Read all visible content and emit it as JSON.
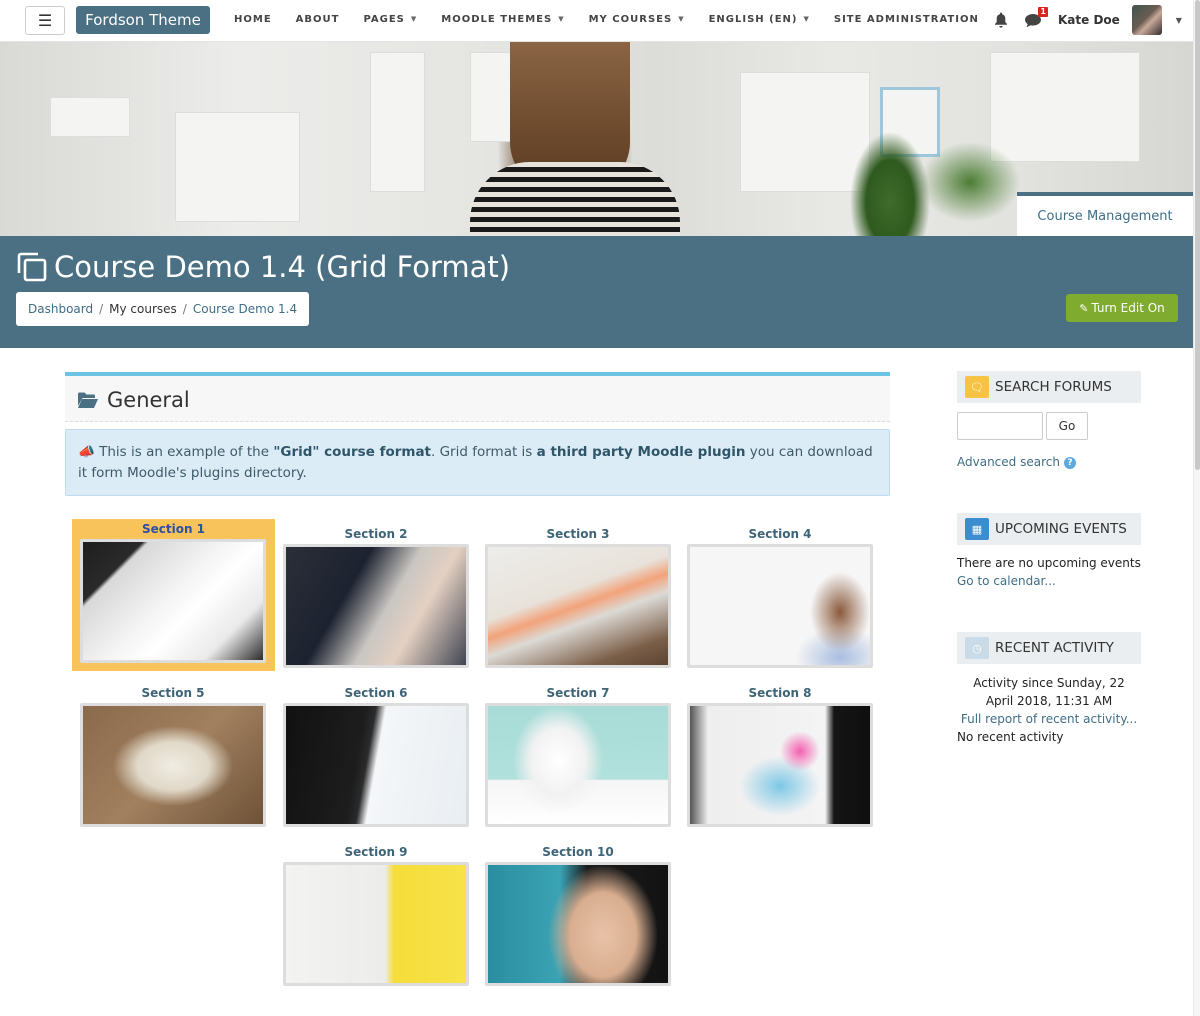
{
  "navbar": {
    "brand": "Fordson Theme",
    "menu": [
      {
        "label": "HOME",
        "dropdown": false
      },
      {
        "label": "ABOUT",
        "dropdown": false
      },
      {
        "label": "PAGES",
        "dropdown": true
      },
      {
        "label": "MOODLE THEMES",
        "dropdown": true
      },
      {
        "label": "MY COURSES",
        "dropdown": true
      },
      {
        "label": "ENGLISH (EN)",
        "dropdown": true
      },
      {
        "label": "SITE ADMINISTRATION",
        "dropdown": false
      }
    ],
    "notifications_icon": "bell-icon",
    "messages_icon": "comment-icon",
    "messages_count": "1",
    "user_name": "Kate Doe",
    "caret": "▾"
  },
  "hero": {
    "course_management_label": "Course Management"
  },
  "header": {
    "title": "Course Demo 1.4 (Grid Format)",
    "breadcrumb": [
      {
        "label": "Dashboard",
        "link": true
      },
      {
        "label": "My courses",
        "link": false
      },
      {
        "label": "Course Demo 1.4",
        "link": true
      }
    ],
    "breadcrumb_separator": "/",
    "edit_button_label": "Turn Edit On"
  },
  "general": {
    "title": "General",
    "notice_parts": {
      "p1": "This is an example of the ",
      "b1": "\"Grid\" course format",
      "p2": ". Grid format is ",
      "b2": "a third party Moodle plugin",
      "p3": " you can download it form Moodle's plugins directory."
    }
  },
  "sections": [
    {
      "label": "Section 1",
      "active": true
    },
    {
      "label": "Section 2",
      "active": false
    },
    {
      "label": "Section 3",
      "active": false
    },
    {
      "label": "Section 4",
      "active": false
    },
    {
      "label": "Section 5",
      "active": false
    },
    {
      "label": "Section 6",
      "active": false
    },
    {
      "label": "Section 7",
      "active": false
    },
    {
      "label": "Section 8",
      "active": false
    },
    {
      "label": "Section 9",
      "active": false
    },
    {
      "label": "Section 10",
      "active": false
    }
  ],
  "sidebar": {
    "search_forums": {
      "title": "SEARCH FORUMS",
      "input_value": "",
      "go_label": "Go",
      "advanced_search": "Advanced search",
      "help_glyph": "?"
    },
    "upcoming_events": {
      "title": "UPCOMING EVENTS",
      "empty_text": "There are no upcoming events",
      "calendar_link": "Go to calendar..."
    },
    "recent_activity": {
      "title": "RECENT ACTIVITY",
      "since_text": "Activity since Sunday, 22 April 2018, 11:31 AM",
      "full_report_link": "Full report of recent activity...",
      "empty_text": "No recent activity"
    }
  },
  "colors": {
    "brand": "#4b7083",
    "accent_blue": "#6cc3e3",
    "edit_green": "#7fab2f",
    "active_section": "#f7c35a",
    "link": "#3f6e86",
    "badge_red": "#d9261c"
  }
}
